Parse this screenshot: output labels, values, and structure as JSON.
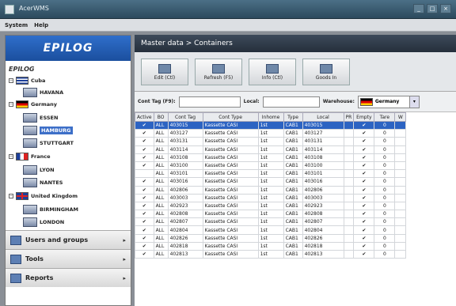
{
  "window": {
    "title": "AcerWMS"
  },
  "menu": [
    "System",
    "Help"
  ],
  "brand": {
    "logo": "EPILOG"
  },
  "tree": {
    "root": "EPILOG",
    "countries": [
      {
        "name": "Cuba",
        "flag": "cuba",
        "warehouses": [
          "HAVANA"
        ]
      },
      {
        "name": "Germany",
        "flag": "germany",
        "warehouses": [
          "ESSEN",
          "HAMBURG",
          "STUTTGART"
        ]
      },
      {
        "name": "France",
        "flag": "france",
        "warehouses": [
          "LYON",
          "NANTES"
        ]
      },
      {
        "name": "United Kingdom",
        "flag": "uk",
        "warehouses": [
          "BIRMINGHAM",
          "LONDON"
        ]
      }
    ],
    "selected": "HAMBURG"
  },
  "accordion": [
    "Users and groups",
    "Tools",
    "Reports"
  ],
  "breadcrumb": "Master data  >  Containers",
  "toolbar": [
    "Edit (Ctl)",
    "Refresh (F5)",
    "Info (Ctl)",
    "Goods In"
  ],
  "filter": {
    "cont_tag_label": "Cont Tag (F9):",
    "local_label": "Local:",
    "warehouse_label": "Warehouse:",
    "warehouse_value": "Germany"
  },
  "table": {
    "columns": [
      "Active",
      "BO",
      "Cont Tag",
      "Cont Type",
      "Inhome",
      "Type",
      "Local",
      "PR",
      "Empty",
      "Tare",
      "W"
    ],
    "rows": [
      [
        "✔",
        "ALL",
        "403015",
        "Kassette CASI",
        "1st",
        "CAB1",
        "403015",
        "",
        "✔",
        "0",
        ""
      ],
      [
        "✔",
        "ALL",
        "403127",
        "Kassette CASI",
        "1st",
        "CAB1",
        "403127",
        "",
        "✔",
        "0",
        ""
      ],
      [
        "✔",
        "ALL",
        "403131",
        "Kassette CASI",
        "1st",
        "CAB1",
        "403131",
        "",
        "✔",
        "0",
        ""
      ],
      [
        "✔",
        "ALL",
        "403114",
        "Kassette CASI",
        "1st",
        "CAB1",
        "403114",
        "",
        "✔",
        "0",
        ""
      ],
      [
        "✔",
        "ALL",
        "403108",
        "Kassette CASI",
        "1st",
        "CAB1",
        "403108",
        "",
        "✔",
        "0",
        ""
      ],
      [
        "✔",
        "ALL",
        "403100",
        "Kassette CASI",
        "1st",
        "CAB1",
        "403100",
        "",
        "✔",
        "0",
        ""
      ],
      [
        "",
        "ALL",
        "403101",
        "Kassette CASI",
        "1st",
        "CAB1",
        "403101",
        "",
        "✔",
        "0",
        ""
      ],
      [
        "✔",
        "ALL",
        "403016",
        "Kassette CASI",
        "1st",
        "CAB1",
        "403016",
        "",
        "✔",
        "0",
        ""
      ],
      [
        "✔",
        "ALL",
        "402806",
        "Kassette CASI",
        "1st",
        "CAB1",
        "402806",
        "",
        "✔",
        "0",
        ""
      ],
      [
        "✔",
        "ALL",
        "403003",
        "Kassette CASI",
        "1st",
        "CAB1",
        "403003",
        "",
        "✔",
        "0",
        ""
      ],
      [
        "✔",
        "ALL",
        "402923",
        "Kassette CASI",
        "1st",
        "CAB1",
        "402923",
        "",
        "✔",
        "0",
        ""
      ],
      [
        "✔",
        "ALL",
        "402808",
        "Kassette CASI",
        "1st",
        "CAB1",
        "402808",
        "",
        "✔",
        "0",
        ""
      ],
      [
        "✔",
        "ALL",
        "402807",
        "Kassette CASI",
        "1st",
        "CAB1",
        "402807",
        "",
        "✔",
        "0",
        ""
      ],
      [
        "✔",
        "ALL",
        "402804",
        "Kassette CASI",
        "1st",
        "CAB1",
        "402804",
        "",
        "✔",
        "0",
        ""
      ],
      [
        "✔",
        "ALL",
        "402826",
        "Kassette CASI",
        "1st",
        "CAB1",
        "402826",
        "",
        "✔",
        "0",
        ""
      ],
      [
        "✔",
        "ALL",
        "402818",
        "Kassette CASI",
        "1st",
        "CAB1",
        "402818",
        "",
        "✔",
        "0",
        ""
      ],
      [
        "✔",
        "ALL",
        "402813",
        "Kassette CASI",
        "1st",
        "CAB1",
        "402813",
        "",
        "✔",
        "0",
        ""
      ]
    ]
  }
}
